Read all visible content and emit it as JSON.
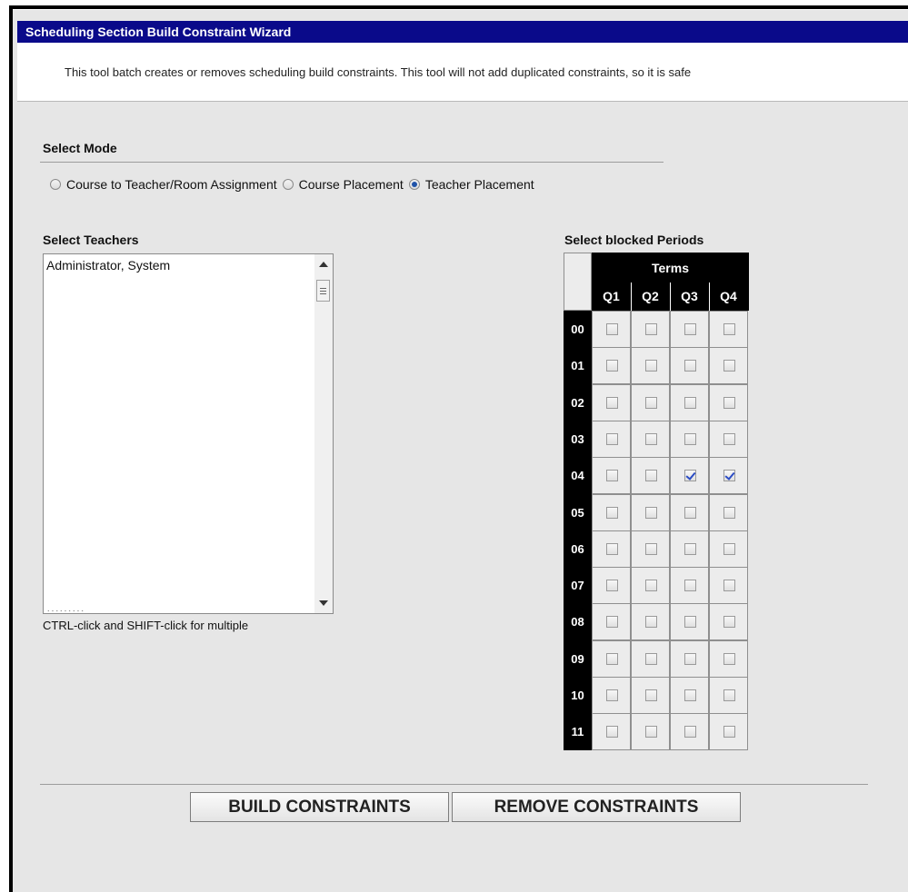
{
  "window": {
    "title": "Scheduling Section Build Constraint Wizard",
    "description": "This tool batch creates or removes scheduling build constraints. This tool will not add duplicated constraints, so it is safe"
  },
  "mode": {
    "label": "Select Mode",
    "options": [
      {
        "label": "Course to Teacher/Room Assignment",
        "selected": false
      },
      {
        "label": "Course Placement",
        "selected": false
      },
      {
        "label": "Teacher Placement",
        "selected": true
      }
    ]
  },
  "teachers": {
    "label": "Select Teachers",
    "items": [
      "Administrator, System"
    ],
    "hint": "CTRL-click and SHIFT-click for multiple"
  },
  "periods": {
    "label": "Select blocked Periods",
    "terms_header": "Terms",
    "terms": [
      "Q1",
      "Q2",
      "Q3",
      "Q4"
    ],
    "rows": [
      {
        "period": "00",
        "checked": [
          false,
          false,
          false,
          false
        ]
      },
      {
        "period": "01",
        "checked": [
          false,
          false,
          false,
          false
        ]
      },
      {
        "period": "02",
        "checked": [
          false,
          false,
          false,
          false
        ]
      },
      {
        "period": "03",
        "checked": [
          false,
          false,
          false,
          false
        ]
      },
      {
        "period": "04",
        "checked": [
          false,
          false,
          true,
          true
        ]
      },
      {
        "period": "05",
        "checked": [
          false,
          false,
          false,
          false
        ]
      },
      {
        "period": "06",
        "checked": [
          false,
          false,
          false,
          false
        ]
      },
      {
        "period": "07",
        "checked": [
          false,
          false,
          false,
          false
        ]
      },
      {
        "period": "08",
        "checked": [
          false,
          false,
          false,
          false
        ]
      },
      {
        "period": "09",
        "checked": [
          false,
          false,
          false,
          false
        ]
      },
      {
        "period": "10",
        "checked": [
          false,
          false,
          false,
          false
        ]
      },
      {
        "period": "11",
        "checked": [
          false,
          false,
          false,
          false
        ]
      }
    ]
  },
  "buttons": {
    "build": "BUILD CONSTRAINTS",
    "remove": "REMOVE CONSTRAINTS"
  },
  "colors": {
    "titlebar": "#0a0a8a",
    "background": "#e6e6e6",
    "check": "#2b4cc4"
  }
}
